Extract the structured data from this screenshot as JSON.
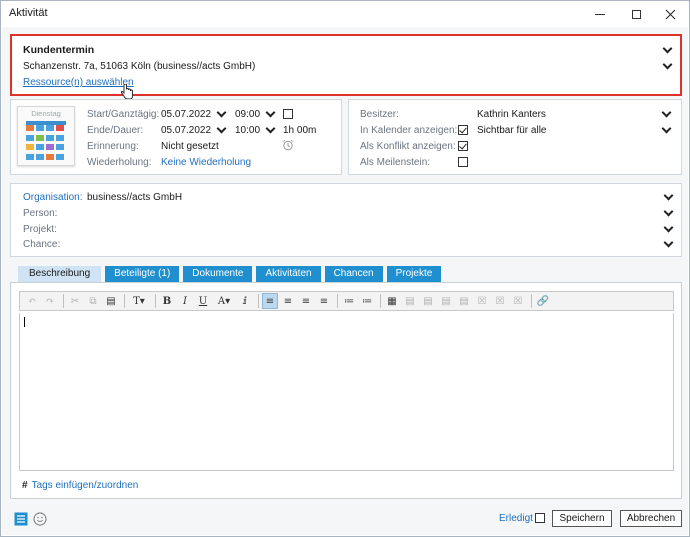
{
  "window": {
    "title": "Aktivität"
  },
  "subject": {
    "title": "Kundentermin",
    "location": "Schanzenstr. 7a, 51063 Köln (business//acts GmbH)",
    "resource_link": "Ressource(n) auswählen"
  },
  "calendar_icon": {
    "day": "Dienstag"
  },
  "dates": {
    "start_label": "Start/Ganztägig:",
    "start_date": "05.07.2022",
    "start_time": "09:00",
    "end_label": "Ende/Dauer:",
    "end_date": "05.07.2022",
    "end_time": "10:00",
    "duration": "1h 00m",
    "reminder_label": "Erinnerung:",
    "reminder_value": "Nicht gesetzt",
    "repeat_label": "Wiederholung:",
    "repeat_value": "Keine Wiederholung"
  },
  "owner": {
    "owner_label": "Besitzer:",
    "owner_value": "Kathrin Kanters",
    "calendar_label": "In Kalender anzeigen:",
    "calendar_value": "Sichtbar für alle",
    "conflict_label": "Als Konflikt anzeigen:",
    "milestone_label": "Als Meilenstein:"
  },
  "relations": {
    "organisation_label": "Organisation:",
    "organisation_value": "business//acts GmbH",
    "person_label": "Person:",
    "project_label": "Projekt:",
    "chance_label": "Chance:"
  },
  "tabs": [
    {
      "label": "Beschreibung"
    },
    {
      "label": "Beteiligte (1)"
    },
    {
      "label": "Dokumente"
    },
    {
      "label": "Aktivitäten"
    },
    {
      "label": "Chancen"
    },
    {
      "label": "Projekte"
    }
  ],
  "editor": {
    "toolbar_icons": [
      "undo-icon",
      "redo-icon",
      "cut-icon",
      "copy-icon",
      "paste-icon",
      "font-size-icon",
      "bold-icon",
      "italic-icon",
      "underline-icon",
      "font-color-icon",
      "clear-format-icon",
      "align-left-icon",
      "align-center-icon",
      "align-right-icon",
      "justify-icon",
      "ordered-list-icon",
      "unordered-list-icon",
      "table-icon",
      "link-icon"
    ],
    "tags_link": "Tags einfügen/zuordnen"
  },
  "footer": {
    "done_label": "Erledigt",
    "save_label": "Speichern",
    "cancel_label": "Abbrechen"
  },
  "colors": {
    "accent": "#1f8fd0",
    "highlight_border": "#e0302a",
    "link": "#1f6fbf"
  }
}
